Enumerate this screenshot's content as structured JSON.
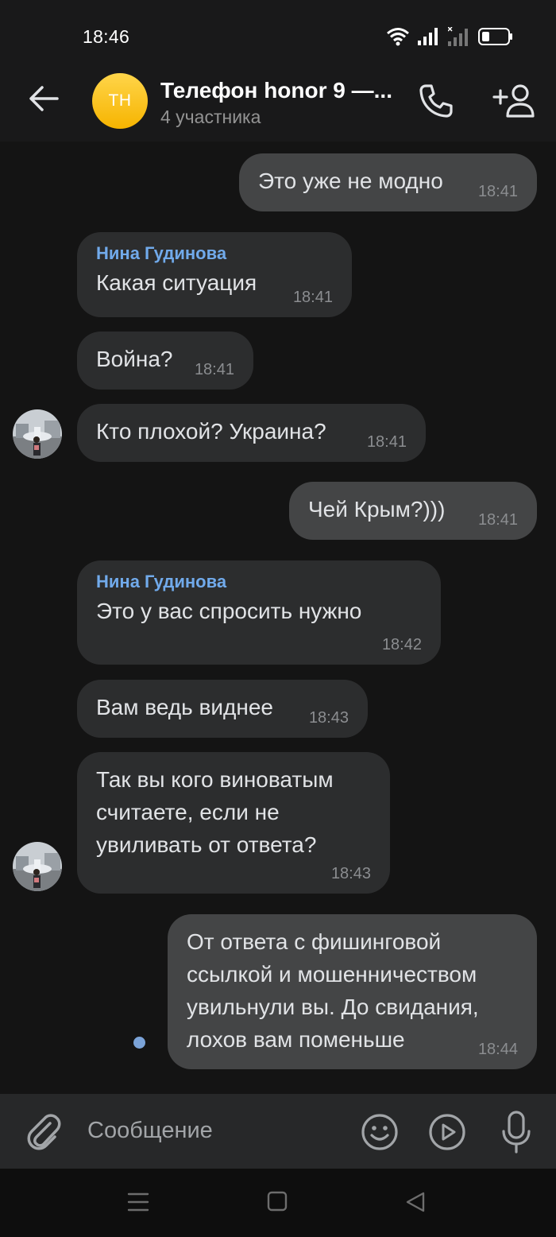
{
  "status_bar": {
    "time": "18:46"
  },
  "header": {
    "avatar_initials": "TH",
    "title": "Телефон honor 9 —...",
    "subtitle": "4 участника"
  },
  "messages": [
    {
      "direction": "out",
      "text": "Это уже не модно",
      "time": "18:41"
    },
    {
      "direction": "in",
      "sender": "Нина Гудинова",
      "text": "Какая ситуация",
      "time": "18:41"
    },
    {
      "direction": "in",
      "text": "Война?",
      "time": "18:41"
    },
    {
      "direction": "in",
      "text": "Кто плохой? Украина?",
      "time": "18:41"
    },
    {
      "direction": "out",
      "text": "Чей Крым?)))",
      "time": "18:41"
    },
    {
      "direction": "in",
      "sender": "Нина Гудинова",
      "text": "Это у вас спросить нужно",
      "time": "18:42"
    },
    {
      "direction": "in",
      "text": "Вам ведь виднее",
      "time": "18:43"
    },
    {
      "direction": "in",
      "text": "Так вы кого виноватым считаете, если не увиливать от ответа?",
      "time": "18:43"
    },
    {
      "direction": "out",
      "text": "От ответа с фишинговой ссылкой и мошенничеством увильнули вы. До свидания, лохов вам поменьше",
      "time": "18:44",
      "unread": true
    }
  ],
  "composer": {
    "placeholder": "Сообщение"
  },
  "colors": {
    "background": "#141414",
    "incoming_bubble": "#2c2d2e",
    "outgoing_bubble": "#444546",
    "sender_name": "#71aaeb",
    "avatar_yellow": "#f6b400",
    "unread_dot": "#7ba3d8"
  },
  "icons": {
    "back": "arrow-left-icon",
    "call": "phone-icon",
    "add_member": "add-user-icon",
    "attach": "paperclip-icon",
    "emoji": "smile-icon",
    "video_message": "play-circle-icon",
    "voice": "microphone-icon"
  }
}
